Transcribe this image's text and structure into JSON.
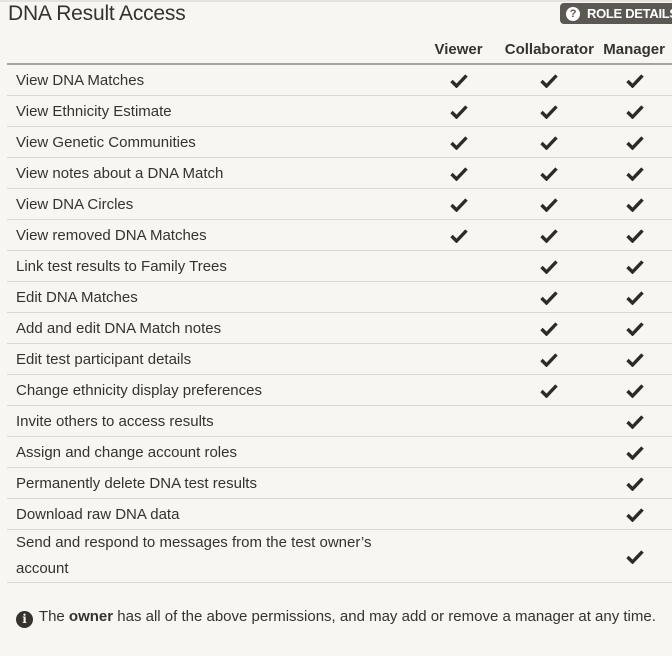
{
  "header": {
    "title": "DNA Result Access",
    "role_details_label": "ROLE DETAILS",
    "role_details_icon": "question-circle-icon"
  },
  "table": {
    "columns": [
      "Viewer",
      "Collaborator",
      "Manager"
    ],
    "rows": [
      {
        "label": "View DNA Matches",
        "viewer": true,
        "collaborator": true,
        "manager": true
      },
      {
        "label": "View Ethnicity Estimate",
        "viewer": true,
        "collaborator": true,
        "manager": true
      },
      {
        "label": "View Genetic Communities",
        "viewer": true,
        "collaborator": true,
        "manager": true
      },
      {
        "label": "View notes about a DNA Match",
        "viewer": true,
        "collaborator": true,
        "manager": true
      },
      {
        "label": "View DNA Circles",
        "viewer": true,
        "collaborator": true,
        "manager": true
      },
      {
        "label": "View removed DNA Matches",
        "viewer": true,
        "collaborator": true,
        "manager": true
      },
      {
        "label": "Link test results to Family Trees",
        "viewer": false,
        "collaborator": true,
        "manager": true
      },
      {
        "label": "Edit DNA Matches",
        "viewer": false,
        "collaborator": true,
        "manager": true
      },
      {
        "label": "Add and edit DNA Match notes",
        "viewer": false,
        "collaborator": true,
        "manager": true
      },
      {
        "label": "Edit test participant details",
        "viewer": false,
        "collaborator": true,
        "manager": true
      },
      {
        "label": "Change ethnicity display preferences",
        "viewer": false,
        "collaborator": true,
        "manager": true
      },
      {
        "label": "Invite others to access results",
        "viewer": false,
        "collaborator": false,
        "manager": true
      },
      {
        "label": "Assign and change account roles",
        "viewer": false,
        "collaborator": false,
        "manager": true
      },
      {
        "label": "Permanently delete DNA test results",
        "viewer": false,
        "collaborator": false,
        "manager": true
      },
      {
        "label": "Download raw DNA data",
        "viewer": false,
        "collaborator": false,
        "manager": true
      },
      {
        "label": "Send and respond to messages from the test owner’s account",
        "viewer": false,
        "collaborator": false,
        "manager": true
      }
    ]
  },
  "footer": {
    "icon": "info-circle-icon",
    "text_before": "The ",
    "text_bold": "owner",
    "text_after": " has all of the above permissions, and may add or remove a manager at any time."
  }
}
